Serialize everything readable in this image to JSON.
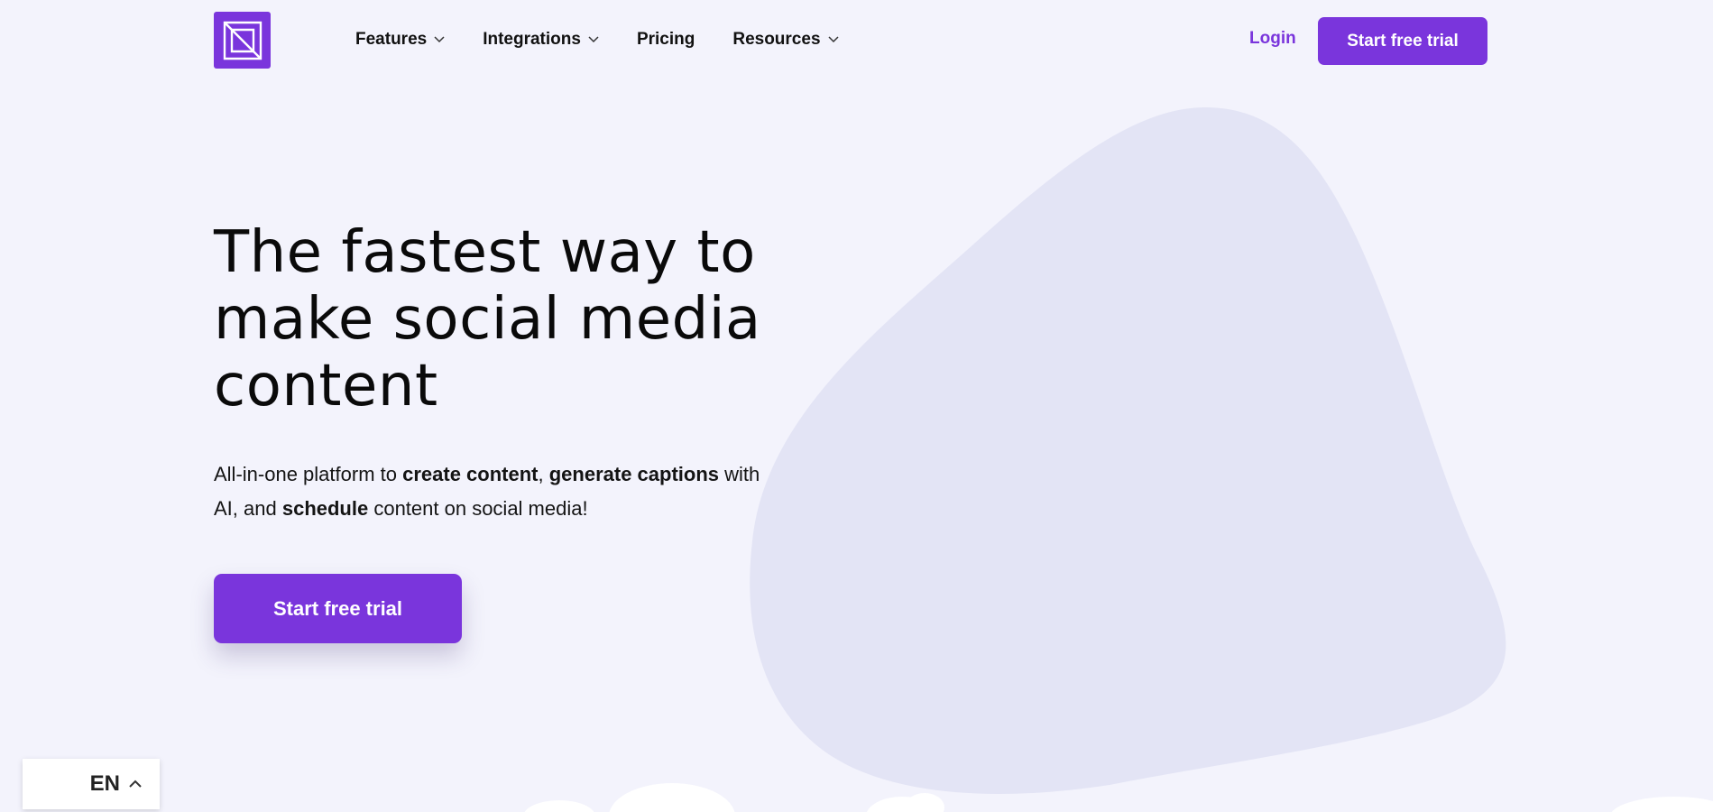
{
  "header": {
    "nav": [
      {
        "label": "Features",
        "has_dropdown": true
      },
      {
        "label": "Integrations",
        "has_dropdown": true
      },
      {
        "label": "Pricing",
        "has_dropdown": false
      },
      {
        "label": "Resources",
        "has_dropdown": true
      }
    ],
    "login_label": "Login",
    "cta_label": "Start free trial"
  },
  "hero": {
    "title": "The fastest way to make social media content",
    "subtitle": {
      "part1": "All-in-one platform to ",
      "bold1": "create content",
      "part2": ", ",
      "bold2": "generate captions",
      "part3": " with AI, and ",
      "bold3": "schedule",
      "part4": " content on social media!"
    },
    "cta_label": "Start free trial"
  },
  "language": {
    "code": "EN"
  },
  "colors": {
    "brand": "#7a35dc",
    "background": "#f3f3fc",
    "blob": "#e3e4f5"
  },
  "icons": {
    "logo": "brand-logo-icon",
    "dropdown": "chevron-down-icon",
    "language_toggle": "chevron-up-icon"
  }
}
